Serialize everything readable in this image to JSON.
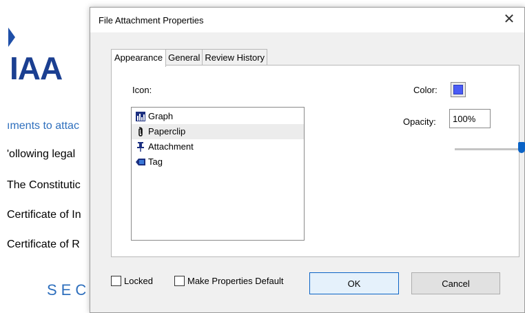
{
  "background": {
    "logo_text": "IAA",
    "lines": [
      "ıments to attac",
      "'ollowing legal",
      "The Constitutic",
      "Certificate of In",
      "Certificate of R"
    ],
    "section_text": "SEC"
  },
  "dialog": {
    "title": "File Attachment Properties",
    "close_glyph": "✕",
    "tabs": [
      {
        "label": "Appearance",
        "active": true
      },
      {
        "label": "General",
        "active": false
      },
      {
        "label": "Review History",
        "active": false
      }
    ],
    "icon_label": "Icon:",
    "icons": [
      {
        "label": "Graph",
        "icon": "graph-icon",
        "selected": false
      },
      {
        "label": "Paperclip",
        "icon": "paperclip-icon",
        "selected": true
      },
      {
        "label": "Attachment",
        "icon": "pushpin-icon",
        "selected": false
      },
      {
        "label": "Tag",
        "icon": "tag-icon",
        "selected": false
      }
    ],
    "color_label": "Color:",
    "color_value": "#4a5cf5",
    "opacity_label": "Opacity:",
    "opacity_value": "100%",
    "opacity_slider": 1.0,
    "locked_label": "Locked",
    "locked_checked": false,
    "make_default_label": "Make Properties Default",
    "make_default_checked": false,
    "ok_label": "OK",
    "cancel_label": "Cancel"
  }
}
